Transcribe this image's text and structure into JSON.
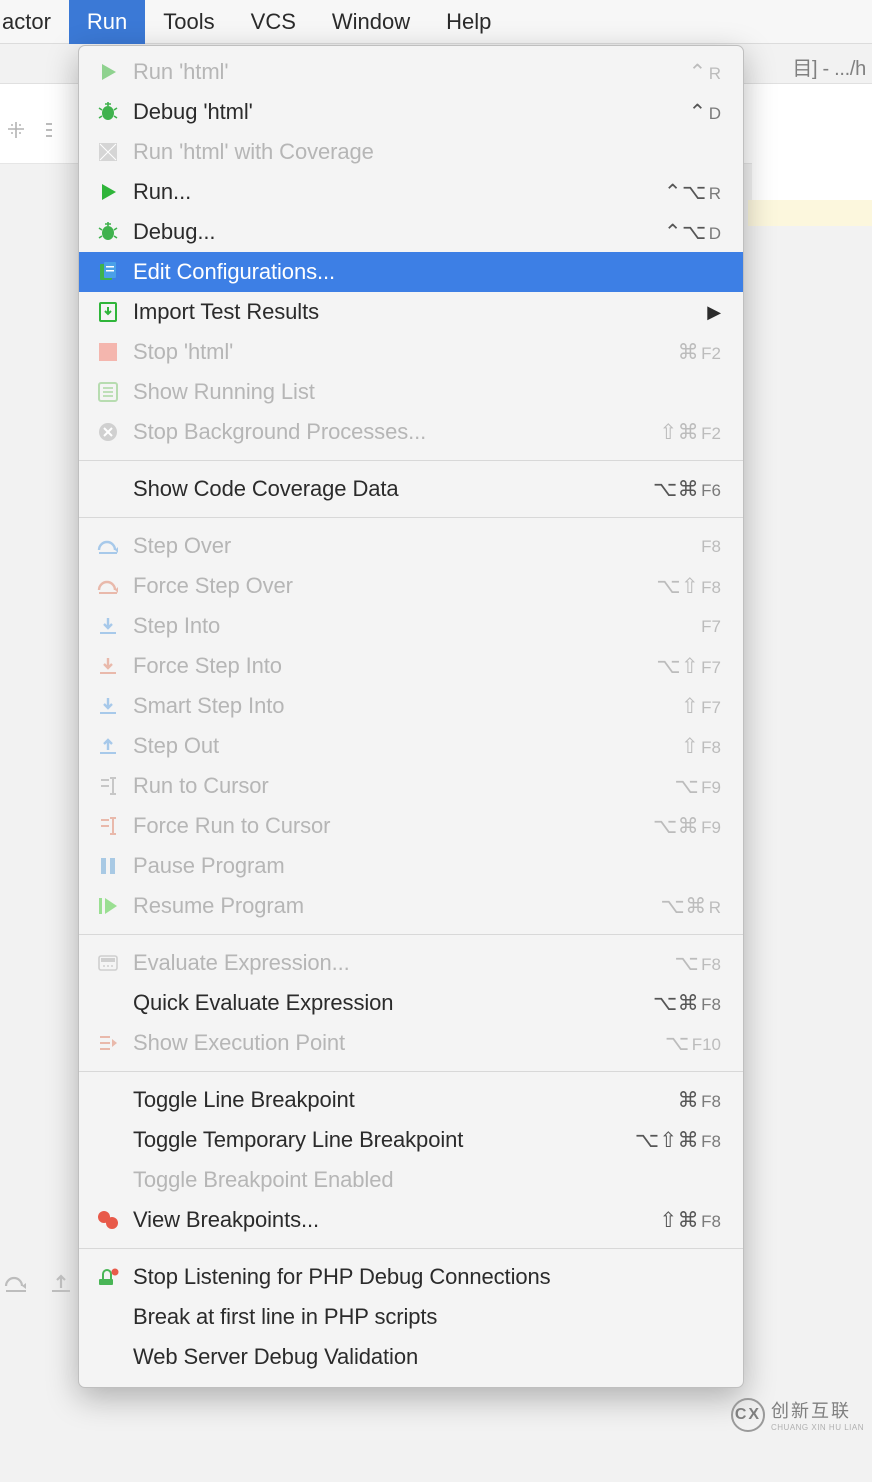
{
  "menubar": {
    "items": [
      {
        "label": "actor",
        "active": false,
        "partial": true
      },
      {
        "label": "Run",
        "active": true,
        "partial": false
      },
      {
        "label": "Tools",
        "active": false,
        "partial": false
      },
      {
        "label": "VCS",
        "active": false,
        "partial": false
      },
      {
        "label": "Window",
        "active": false,
        "partial": false
      },
      {
        "label": "Help",
        "active": false,
        "partial": false
      }
    ]
  },
  "breadcrumb": {
    "text": "目] - .../h"
  },
  "dropdown": {
    "groups": [
      [
        {
          "icon": "play-icon",
          "iconColor": "#8fd28f",
          "label": "Run 'html'",
          "shortcut": "⌃",
          "suffix": "R",
          "disabled": true
        },
        {
          "icon": "bug-icon",
          "iconColor": "#3fb24d",
          "label": "Debug 'html'",
          "shortcut": "⌃",
          "suffix": "D",
          "disabled": false
        },
        {
          "icon": "coverage-icon",
          "iconColor": "#c9c9c9",
          "label": "Run 'html' with Coverage",
          "shortcut": "",
          "suffix": "",
          "disabled": true
        },
        {
          "icon": "play-icon",
          "iconColor": "#2fb53a",
          "label": "Run...",
          "shortcut": "⌃⌥",
          "suffix": "R",
          "disabled": false
        },
        {
          "icon": "bug-icon",
          "iconColor": "#3fb24d",
          "label": "Debug...",
          "shortcut": "⌃⌥",
          "suffix": "D",
          "disabled": false
        },
        {
          "icon": "edit-config-icon",
          "iconColor": "#4aa0e8",
          "label": "Edit Configurations...",
          "shortcut": "",
          "suffix": "",
          "disabled": false,
          "selected": true
        },
        {
          "icon": "import-icon",
          "iconColor": "#2fb53a",
          "label": "Import Test Results",
          "shortcut": "",
          "suffix": "",
          "disabled": false,
          "submenu": true
        },
        {
          "icon": "stop-icon",
          "iconColor": "#f4b6ae",
          "label": "Stop 'html'",
          "shortcut": "⌘",
          "suffix": "F2",
          "disabled": true
        },
        {
          "icon": "list-icon",
          "iconColor": "#b7dcb0",
          "label": "Show Running List",
          "shortcut": "",
          "suffix": "",
          "disabled": true
        },
        {
          "icon": "close-circle-icon",
          "iconColor": "#d0d0d0",
          "label": "Stop Background Processes...",
          "shortcut": "⇧⌘",
          "suffix": "F2",
          "disabled": true
        }
      ],
      [
        {
          "icon": "",
          "label": "Show Code Coverage Data",
          "shortcut": "⌥⌘",
          "suffix": "F6",
          "disabled": false
        }
      ],
      [
        {
          "icon": "step-over-icon",
          "iconColor": "#a7c9ea",
          "label": "Step Over",
          "shortcut": "",
          "suffix": "F8",
          "disabled": true
        },
        {
          "icon": "force-step-over-icon",
          "iconColor": "#e9b9ab",
          "label": "Force Step Over",
          "shortcut": "⌥⇧",
          "suffix": "F8",
          "disabled": true
        },
        {
          "icon": "step-into-icon",
          "iconColor": "#a7c9ea",
          "label": "Step Into",
          "shortcut": "",
          "suffix": "F7",
          "disabled": true
        },
        {
          "icon": "force-step-into-icon",
          "iconColor": "#e9b9ab",
          "label": "Force Step Into",
          "shortcut": "⌥⇧",
          "suffix": "F7",
          "disabled": true
        },
        {
          "icon": "smart-step-into-icon",
          "iconColor": "#a7c9ea",
          "label": "Smart Step Into",
          "shortcut": "⇧",
          "suffix": "F7",
          "disabled": true
        },
        {
          "icon": "step-out-icon",
          "iconColor": "#a7c9ea",
          "label": "Step Out",
          "shortcut": "⇧",
          "suffix": "F8",
          "disabled": true
        },
        {
          "icon": "run-to-cursor-icon",
          "iconColor": "#c7c7c7",
          "label": "Run to Cursor",
          "shortcut": "⌥",
          "suffix": "F9",
          "disabled": true
        },
        {
          "icon": "force-run-to-cursor-icon",
          "iconColor": "#e9b9ab",
          "label": "Force Run to Cursor",
          "shortcut": "⌥⌘",
          "suffix": "F9",
          "disabled": true
        },
        {
          "icon": "pause-icon",
          "iconColor": "#a8c9e4",
          "label": "Pause Program",
          "shortcut": "",
          "suffix": "",
          "disabled": true
        },
        {
          "icon": "resume-icon",
          "iconColor": "#9adf92",
          "label": "Resume Program",
          "shortcut": "⌥⌘",
          "suffix": "R",
          "disabled": true
        }
      ],
      [
        {
          "icon": "evaluate-icon",
          "iconColor": "#cfcfcf",
          "label": "Evaluate Expression...",
          "shortcut": "⌥",
          "suffix": "F8",
          "disabled": true
        },
        {
          "icon": "",
          "label": "Quick Evaluate Expression",
          "shortcut": "⌥⌘",
          "suffix": "F8",
          "disabled": false
        },
        {
          "icon": "exec-point-icon",
          "iconColor": "#e9b9ab",
          "label": "Show Execution Point",
          "shortcut": "⌥",
          "suffix": "F10",
          "disabled": true
        }
      ],
      [
        {
          "icon": "",
          "label": "Toggle Line Breakpoint",
          "shortcut": "⌘",
          "suffix": "F8",
          "disabled": false
        },
        {
          "icon": "",
          "label": "Toggle Temporary Line Breakpoint",
          "shortcut": "⌥⇧⌘",
          "suffix": "F8",
          "disabled": false
        },
        {
          "icon": "",
          "label": "Toggle Breakpoint Enabled",
          "shortcut": "",
          "suffix": "",
          "disabled": true
        },
        {
          "icon": "breakpoints-icon",
          "iconColor": "#e85a4a",
          "label": "View Breakpoints...",
          "shortcut": "⇧⌘",
          "suffix": "F8",
          "disabled": false
        }
      ],
      [
        {
          "icon": "php-listen-icon",
          "iconColor": "#49b556",
          "label": "Stop Listening for PHP Debug Connections",
          "shortcut": "",
          "suffix": "",
          "disabled": false
        },
        {
          "icon": "",
          "label": "Break at first line in PHP scripts",
          "shortcut": "",
          "suffix": "",
          "disabled": false
        },
        {
          "icon": "",
          "label": "Web Server Debug Validation",
          "shortcut": "",
          "suffix": "",
          "disabled": false
        }
      ]
    ]
  },
  "watermark": {
    "logo": "CX",
    "text": "创新互联",
    "sub": "CHUANG XIN HU LIAN"
  }
}
